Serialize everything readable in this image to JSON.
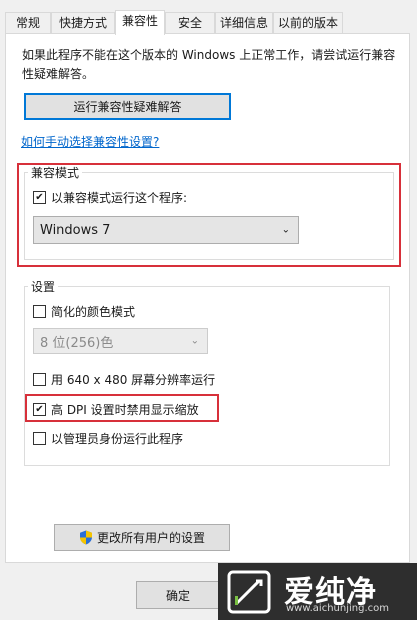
{
  "tabs": [
    {
      "label": "常规"
    },
    {
      "label": "快捷方式"
    },
    {
      "label": "兼容性"
    },
    {
      "label": "安全"
    },
    {
      "label": "详细信息"
    },
    {
      "label": "以前的版本"
    }
  ],
  "intro_text": "如果此程序不能在这个版本的 Windows 上正常工作，请尝试运行兼容性疑难解答。",
  "troubleshoot_button": "运行兼容性疑难解答",
  "manual_link": "如何手动选择兼容性设置?",
  "compat_mode": {
    "group_label": "兼容模式",
    "checkbox_label": "以兼容模式运行这个程序:",
    "checked": true,
    "selected_os": "Windows 7"
  },
  "settings": {
    "group_label": "设置",
    "reduced_color": {
      "label": "简化的颜色模式",
      "checked": false
    },
    "color_option": "8 位(256)色",
    "res_640": {
      "label": "用 640 x 480 屏幕分辨率运行",
      "checked": false
    },
    "high_dpi": {
      "label": "高 DPI 设置时禁用显示缩放",
      "checked": true
    },
    "admin": {
      "label": "以管理员身份运行此程序",
      "checked": false
    }
  },
  "all_users_button": "更改所有用户的设置",
  "ok_button": "确定",
  "watermark": {
    "brand": "爱纯净",
    "url": "www.aichunjing.com"
  },
  "colors": {
    "highlight": "#d7303a",
    "link": "#0066cc",
    "focus": "#0078d7"
  }
}
